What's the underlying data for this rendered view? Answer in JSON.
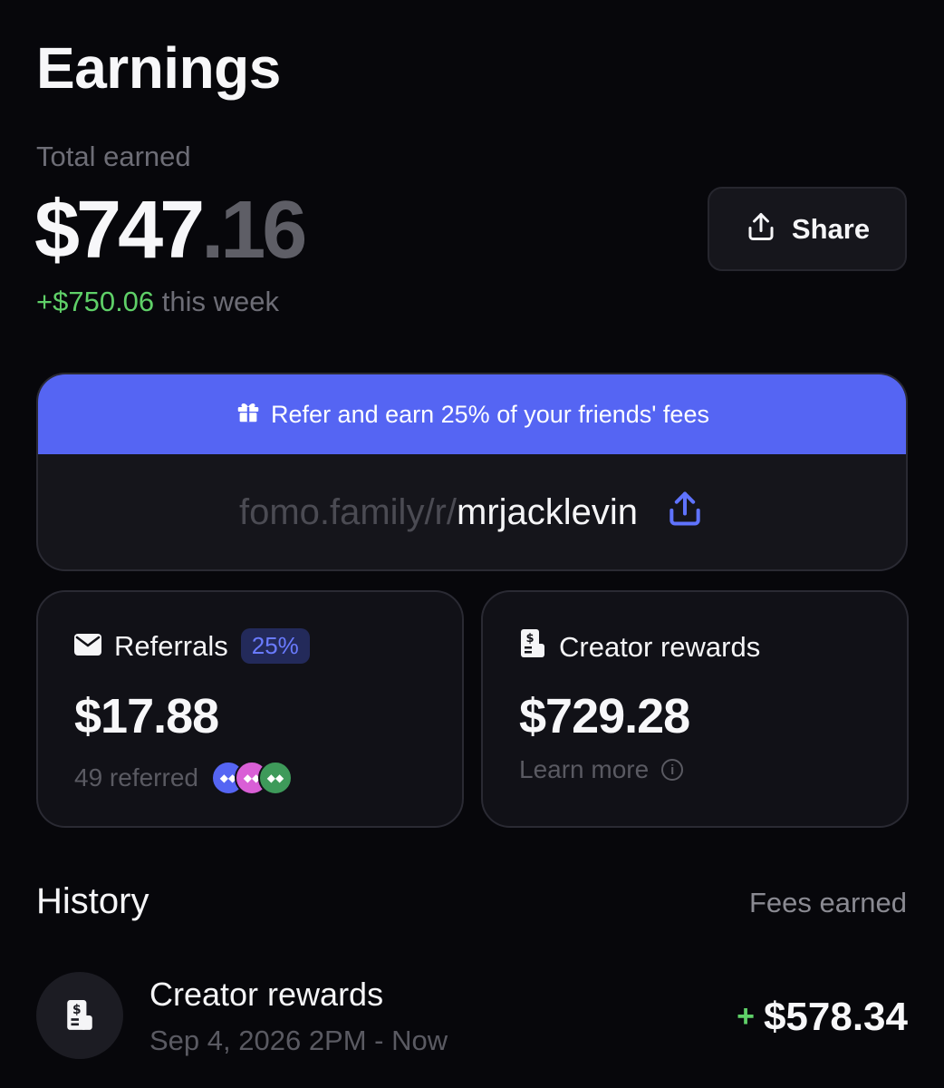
{
  "header": {
    "title": "Earnings"
  },
  "summary": {
    "label": "Total earned",
    "amount_whole": "$747",
    "amount_cents": ".16",
    "week_gain": "+$750.06",
    "week_suffix": " this week",
    "gain_color": "#5fd068"
  },
  "share": {
    "label": "Share",
    "icon": "share-icon"
  },
  "refer": {
    "banner_text": "Refer and earn 25% of your friends' fees",
    "banner_icon": "gift-icon",
    "banner_color": "#5565f3",
    "link_prefix": "fomo.family/r/",
    "link_handle": "mrjacklevin",
    "link_icon": "share-icon"
  },
  "referrals": {
    "label": "Referrals",
    "badge": "25%",
    "value": "$17.88",
    "footer": "49 referred",
    "icon": "envelope-icon",
    "avatar_colors": [
      "#5565f3",
      "#d95fd6",
      "#3e9a5a"
    ]
  },
  "creator": {
    "label": "Creator rewards",
    "value": "$729.28",
    "footer": "Learn more",
    "icon": "receipt-icon",
    "info_icon": "info-icon"
  },
  "history": {
    "title": "History",
    "column_label": "Fees earned",
    "rows": [
      {
        "name": "Creator rewards",
        "date": "Sep 4, 2026 2PM - Now",
        "sign": "+",
        "amount": "$578.34",
        "icon": "receipt-icon"
      }
    ]
  }
}
